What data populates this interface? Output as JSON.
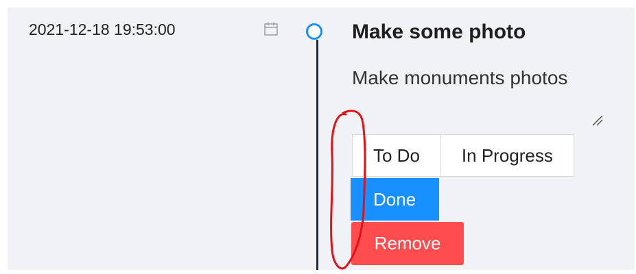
{
  "item": {
    "timestamp": "2021-12-18 19:53:00",
    "title": "Make some photo",
    "description": "Make monuments photos"
  },
  "status_buttons": {
    "todo_label": "To Do",
    "in_progress_label": "In Progress",
    "done_label": "Done"
  },
  "actions": {
    "remove_label": "Remove"
  },
  "icons": {
    "calendar": "calendar-icon",
    "timeline_dot": "timeline-dot-icon",
    "resize": "resize-handle-icon"
  },
  "colors": {
    "background": "#f0f2f5",
    "timeline_dot": "#1890ff",
    "timeline_line": "#1f2a3a",
    "done_button": "#1890ff",
    "remove_button": "#ff4d4f",
    "annotation": "#e0121a"
  }
}
